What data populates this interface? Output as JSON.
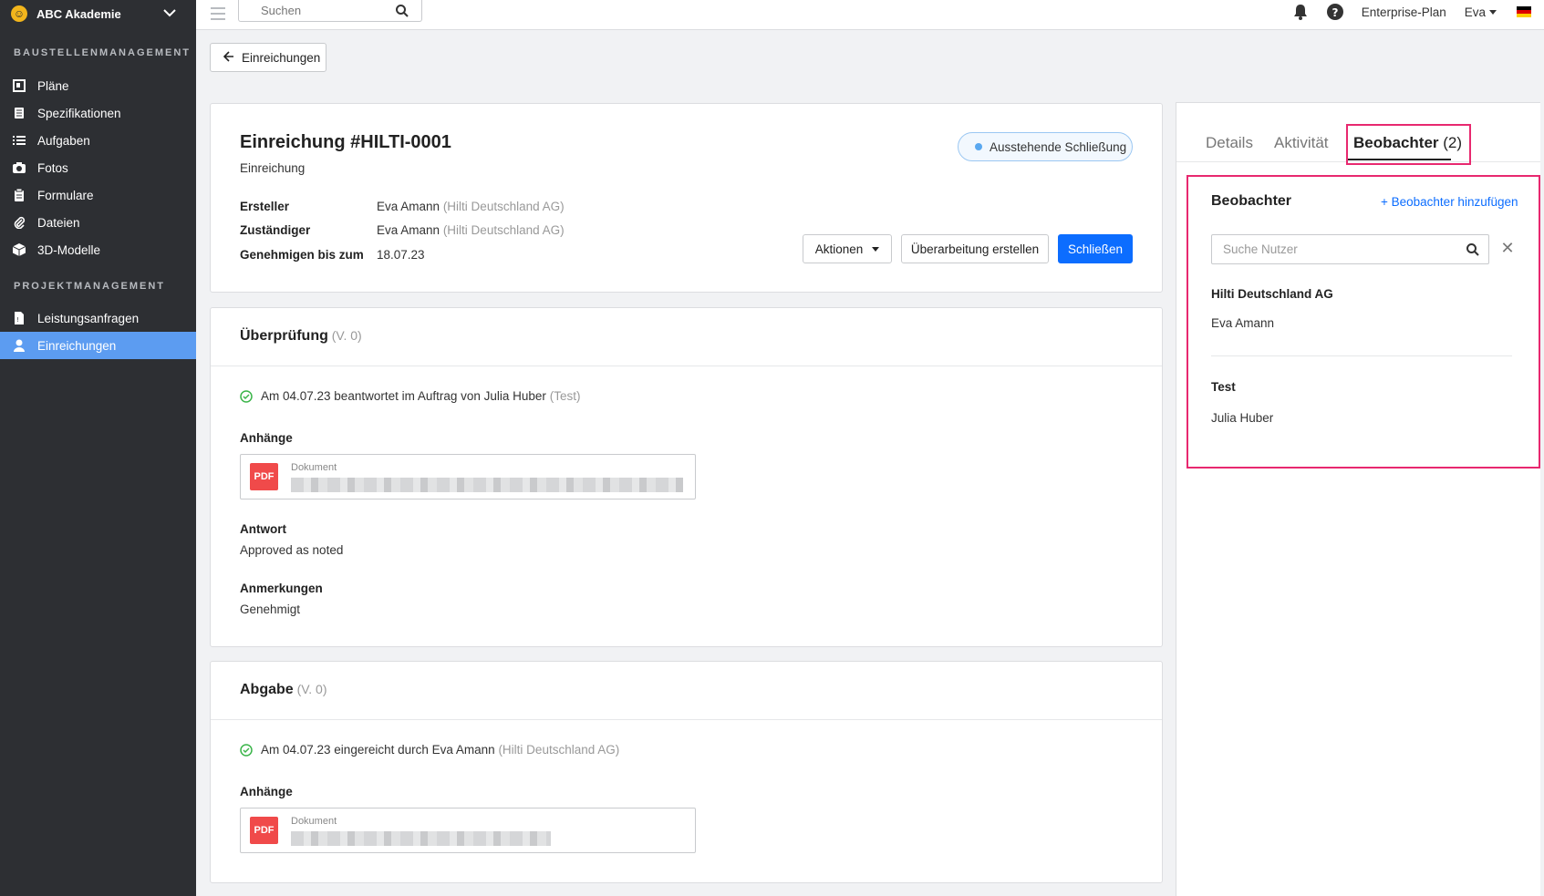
{
  "sidebar": {
    "brand": "ABC Akademie",
    "sections": [
      {
        "label": "BAUSTELLENMANAGEMENT",
        "items": [
          {
            "label": "Pläne",
            "icon": "plans-icon"
          },
          {
            "label": "Spezifikationen",
            "icon": "specifications-icon"
          },
          {
            "label": "Aufgaben",
            "icon": "list-icon"
          },
          {
            "label": "Fotos",
            "icon": "camera-icon"
          },
          {
            "label": "Formulare",
            "icon": "clipboard-icon"
          },
          {
            "label": "Dateien",
            "icon": "paperclip-icon"
          },
          {
            "label": "3D-Modelle",
            "icon": "cube-icon"
          }
        ]
      },
      {
        "label": "PROJEKTMANAGEMENT",
        "items": [
          {
            "label": "Leistungsanfragen",
            "icon": "document-icon"
          },
          {
            "label": "Einreichungen",
            "icon": "user-icon",
            "active": true
          }
        ]
      }
    ]
  },
  "topbar": {
    "search_placeholder": "Suchen",
    "plan": "Enterprise-Plan",
    "user": "Eva"
  },
  "back_button": "Einreichungen",
  "submission": {
    "title": "Einreichung #HILTI-0001",
    "subtitle": "Einreichung",
    "status": "Ausstehende Schließung",
    "status_color": "#5aa8f0",
    "meta": [
      {
        "key": "Ersteller",
        "name": "Eva Amann",
        "org": "(Hilti Deutschland AG)"
      },
      {
        "key": "Zuständiger",
        "name": "Eva Amann",
        "org": "(Hilti Deutschland AG)"
      },
      {
        "key": "Genehmigen bis zum",
        "name": "18.07.23",
        "org": ""
      }
    ],
    "actions": {
      "actions_label": "Aktionen",
      "revision_label": "Überarbeitung erstellen",
      "close_label": "Schließen"
    }
  },
  "review": {
    "title": "Überprüfung",
    "version": "(V. 0)",
    "answered_text": "Am 04.07.23 beantwortet im Auftrag von Julia Huber",
    "answered_org": "(Test)",
    "attachments_label": "Anhänge",
    "attachment_type": "PDF",
    "attachment_label": "Dokument",
    "answer_label": "Antwort",
    "answer_value": "Approved as noted",
    "remarks_label": "Anmerkungen",
    "remarks_value": "Genehmigt"
  },
  "submittal": {
    "title": "Abgabe",
    "version": "(V. 0)",
    "submitted_text": "Am 04.07.23 eingereicht durch Eva Amann",
    "submitted_org": "(Hilti Deutschland AG)",
    "attachments_label": "Anhänge",
    "attachment_type": "PDF",
    "attachment_label": "Dokument"
  },
  "panel": {
    "tabs": {
      "details": "Details",
      "activity": "Aktivität",
      "watchers": "Beobachter",
      "watchers_count": "(2)"
    },
    "title": "Beobachter",
    "add_link": "+ Beobachter hinzufügen",
    "search_placeholder": "Suche Nutzer",
    "groups": [
      {
        "company": "Hilti Deutschland AG",
        "members": [
          "Eva Amann"
        ]
      },
      {
        "company": "Test",
        "members": [
          "Julia Huber"
        ]
      }
    ]
  },
  "colors": {
    "accent": "#0c6dff",
    "sidebar_active": "#5c9cf1",
    "highlight": "#e8286f",
    "success": "#3bb54a"
  }
}
